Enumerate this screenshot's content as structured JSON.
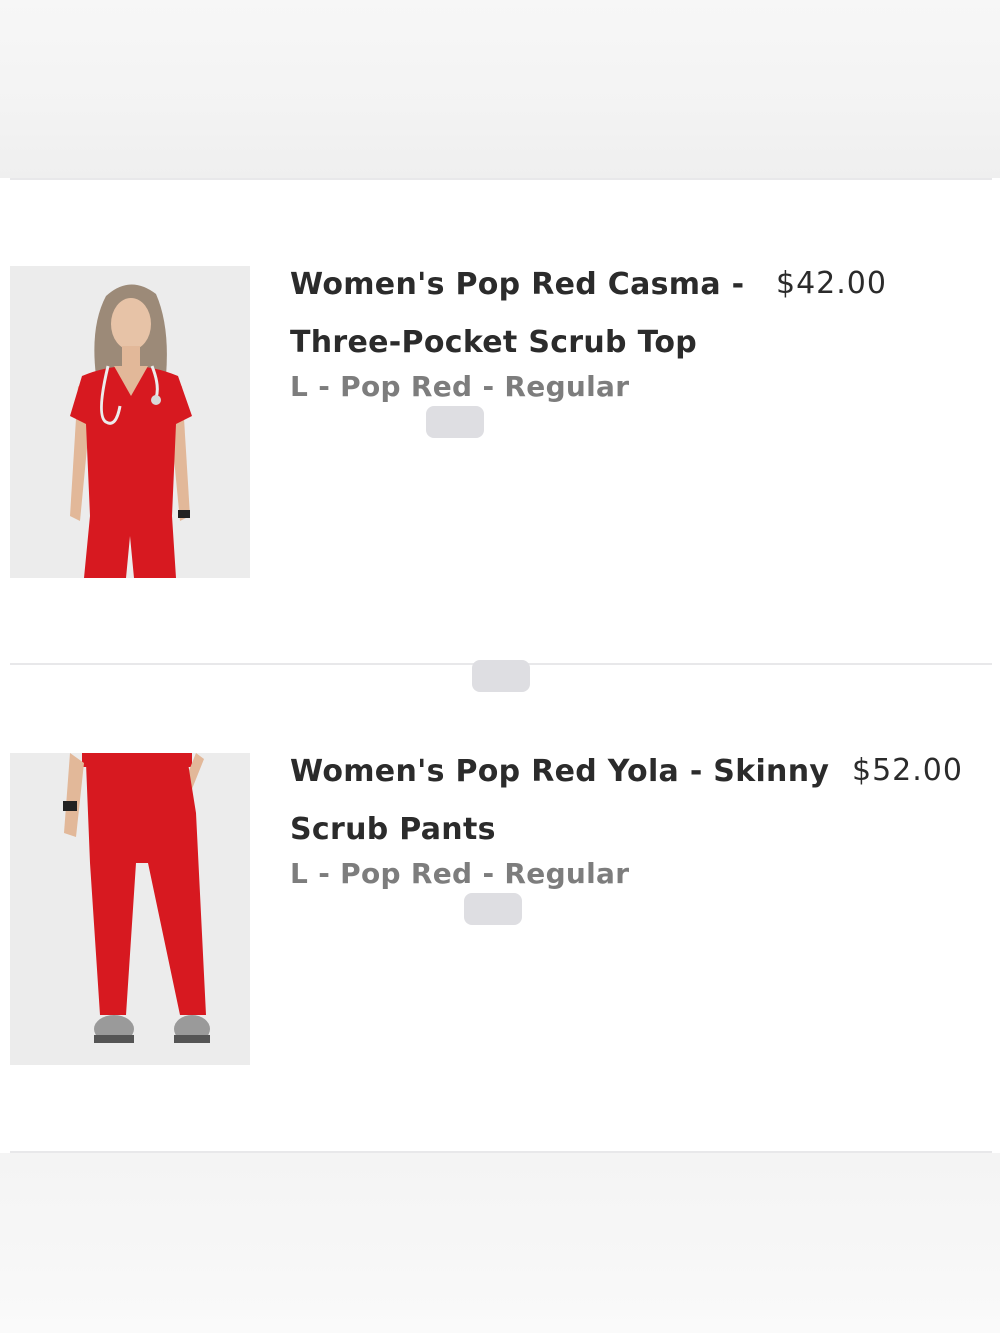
{
  "cart": {
    "items": [
      {
        "title_line1": "Women's Pop Red Casma -",
        "title_line2": "Three-Pocket Scrub Top",
        "variant": "L - Pop Red - Regular",
        "price": "$42.00",
        "image_icon": "scrub-top-photo",
        "color": "#d71920"
      },
      {
        "title_line1": "Women's Pop Red Yola - Skinny",
        "title_line2": "Scrub Pants",
        "variant": "L - Pop Red - Regular",
        "price": "$52.00",
        "image_icon": "scrub-pants-photo",
        "color": "#d71920"
      }
    ]
  },
  "colors": {
    "accent": "#d71920",
    "text": "#2b2b2b",
    "muted": "#7d7d7d",
    "divider": "#e8e8ea"
  }
}
